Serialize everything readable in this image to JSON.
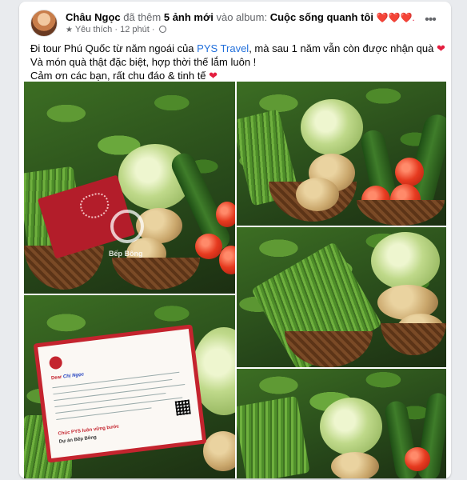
{
  "post": {
    "author": "Châu Ngọc",
    "action": "đã thêm",
    "photo_count": "5 ảnh mới",
    "album_prefix": "vào album:",
    "album": "Cuộc sống quanh tôi",
    "album_hearts": "❤️❤️❤️.",
    "tag": "Yêu thích",
    "separator": "·",
    "time": "12 phút",
    "more_label": "•••",
    "line1_before_link": "Đi tour Phú Quốc từ năm ngoái của ",
    "line1_link": "PYS Travel",
    "line1_after_link": ", mà sau 1 năm vẫn còn được nhận quà",
    "line1_heart": "❤",
    "line2": "Và món quà thật đặc biệt, hợp thời thế lắm luôn !",
    "line3": "Cảm ơn các bạn, rất chu đáo & tinh tế",
    "line3_heart": "❤"
  },
  "photos": {
    "watermark": "Bếp Bông",
    "note_greeting": "Dear ",
    "note_name": "Chị Ngọc",
    "note_footer_1": "Chúc PYS luôn vững bước",
    "note_footer_2": "Dự án Bếp Bông"
  },
  "colors": {
    "link": "#216fdb",
    "heart": "#e41e3f",
    "meta": "#65676b"
  }
}
